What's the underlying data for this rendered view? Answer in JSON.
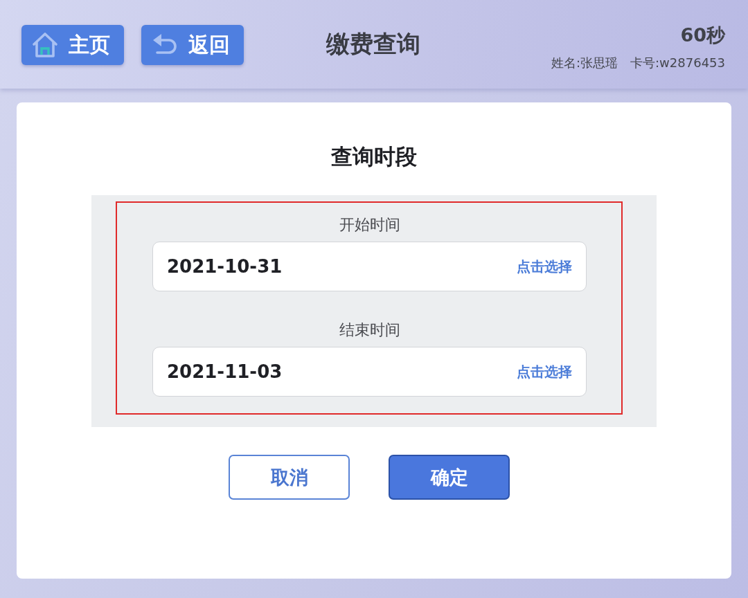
{
  "header": {
    "buttons": [
      {
        "kind": "home",
        "label": "主页"
      },
      {
        "kind": "back",
        "label": "返回"
      }
    ],
    "title": "缴费查询",
    "countdown": "60秒",
    "user_name": "姓名:张思瑶",
    "card_number": "卡号:w2876453"
  },
  "dialog": {
    "title": "查询时段",
    "highlighted": true,
    "fields": [
      {
        "label": "开始时间",
        "value": "2021-10-31",
        "action": "点击选择"
      },
      {
        "label": "结束时间",
        "value": "2021-11-03",
        "action": "点击选择"
      }
    ],
    "buttons": [
      {
        "kind": "secondary",
        "label": "取消"
      },
      {
        "kind": "primary",
        "label": "确定"
      }
    ]
  }
}
